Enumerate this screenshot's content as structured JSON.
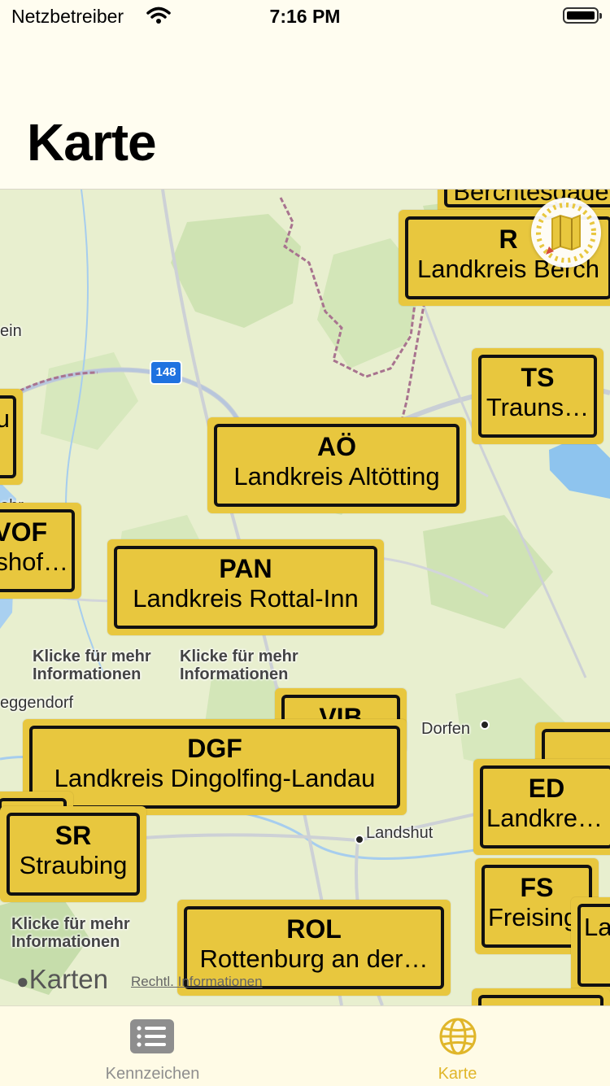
{
  "status_bar": {
    "carrier": "Netzbetreiber",
    "time": "7:16 PM"
  },
  "nav": {
    "title": "Karte"
  },
  "map": {
    "places": [
      "ein",
      "eggendorf",
      "Dorfen",
      "Landshut",
      "ehr"
    ],
    "road_badge": "148",
    "info_hint_line1": "Klicke für mehr",
    "info_hint_line2": "Informationen",
    "plates": [
      {
        "code": "",
        "name": "Berchtesgade"
      },
      {
        "code": "R",
        "name": "Landkreis Berch"
      },
      {
        "code": "TS",
        "name": "Trauns…"
      },
      {
        "code": "",
        "name": "u"
      },
      {
        "code": "AÖ",
        "name": "Landkreis Altötting"
      },
      {
        "code": "VOF",
        "name": "shof…"
      },
      {
        "code": "PAN",
        "name": "Landkreis Rottal-Inn"
      },
      {
        "code": "VIB",
        "name": ""
      },
      {
        "code": "DGF",
        "name": "Landkreis Dingolfing-Landau"
      },
      {
        "code": "ED",
        "name": "Landkrei…"
      },
      {
        "code": "SR",
        "name": "Straubing"
      },
      {
        "code": "FS",
        "name": "Freising"
      },
      {
        "code": "ROL",
        "name": "Rottenburg an der…"
      },
      {
        "code": "",
        "name": "La"
      }
    ],
    "attribution": "Karten",
    "legal": "Rechtl. Informationen"
  },
  "tabs": [
    {
      "label": "Kennzeichen",
      "icon": "list-icon",
      "color": "#8e8e8e",
      "selected": false
    },
    {
      "label": "Karte",
      "icon": "globe-icon",
      "color": "#e0b62a",
      "selected": true
    }
  ]
}
